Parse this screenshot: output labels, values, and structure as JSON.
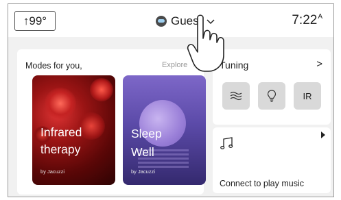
{
  "header": {
    "temperature": "↑99°",
    "user_name": "Guest",
    "time": "7:22",
    "time_suffix": "A"
  },
  "modes": {
    "title": "Modes for you,",
    "explore_label": "Explore",
    "explore_arrow": ">",
    "cards": [
      {
        "name_line1": "Infrared",
        "name_line2": "therapy",
        "by": "by Jacuzzi"
      },
      {
        "name_line1": "Sleep",
        "name_line2": "Well",
        "by": "by Jacuzzi"
      }
    ]
  },
  "tuning": {
    "title": "Tuning",
    "arrow": ">",
    "buttons": [
      {
        "icon": "waves-icon"
      },
      {
        "icon": "lightbulb-icon"
      },
      {
        "label": "IR"
      }
    ]
  },
  "music": {
    "label": "Connect to play music",
    "icon": "music-note-icon"
  },
  "colors": {
    "background": "#f1f1f1",
    "card": "#ffffff",
    "button": "#d9d9d9",
    "infrared": "#9a1414",
    "sleep": "#5b4aa8"
  }
}
